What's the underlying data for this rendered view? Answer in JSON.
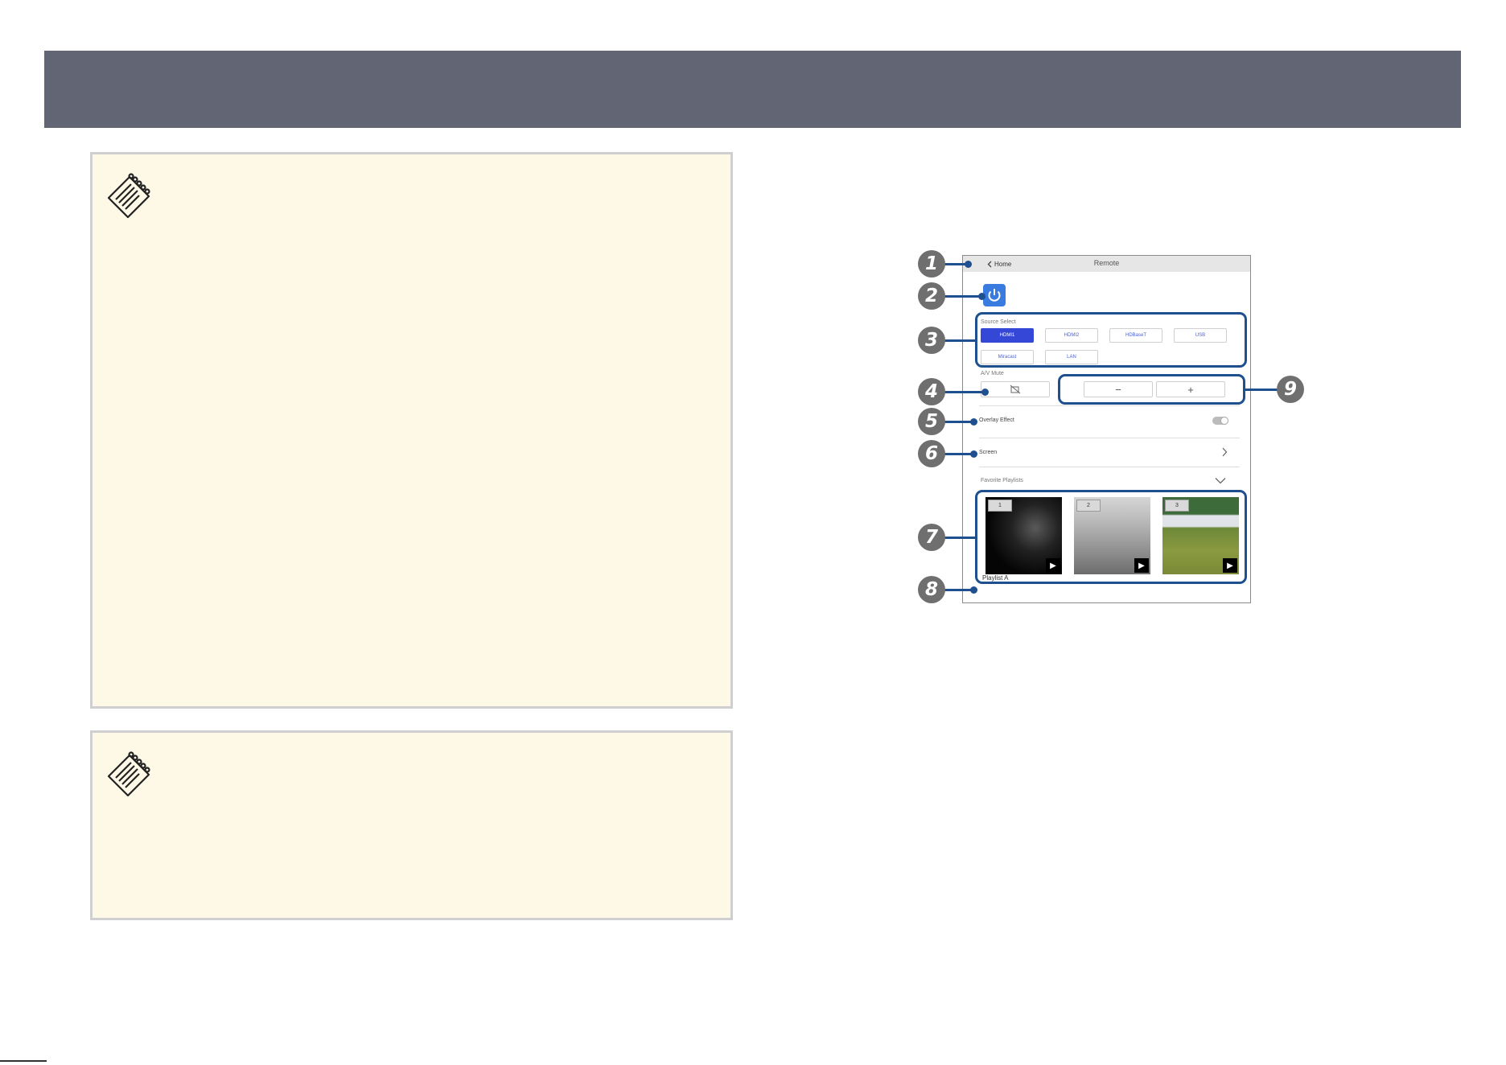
{
  "remote": {
    "home_label": "Home",
    "title": "Remote",
    "source_label": "Source Select",
    "sources": [
      "HDMI1",
      "HDMI2",
      "HDBaseT",
      "USB",
      "Miracast",
      "LAN"
    ],
    "active_source": "HDMI1",
    "av_mute_label": "A/V Mute",
    "volume_down": "−",
    "volume_up": "+",
    "overlay_label": "Overlay Effect",
    "screen_label": "Screen",
    "favorites_label": "Favorite Playlists",
    "thumbs": [
      "1",
      "2",
      "3"
    ],
    "playlist_name": "Playlist A"
  },
  "callouts": [
    "1",
    "2",
    "3",
    "4",
    "5",
    "6",
    "7",
    "8",
    "9"
  ],
  "colors": {
    "header": "#626573",
    "note_bg": "#fdf9e6",
    "callout_line": "#1e4f8e",
    "active_source": "#3547d6"
  },
  "icons": [
    "note-icon",
    "back-chevron-icon",
    "power-icon",
    "av-mute-icon",
    "chevron-right-icon",
    "chevron-down-icon",
    "play-icon"
  ]
}
